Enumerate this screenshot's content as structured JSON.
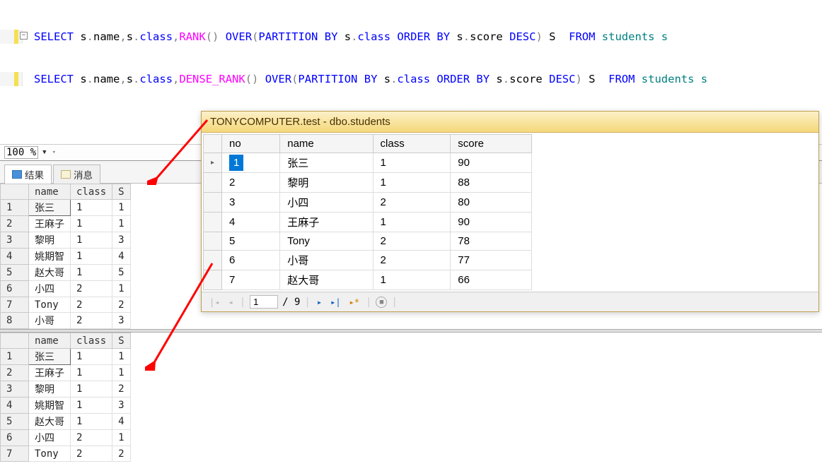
{
  "sql": {
    "line1": {
      "select": "SELECT",
      "cols": " s",
      "dot1": ".",
      "name": "name",
      "comma1": ",",
      "s2": "s",
      "dot2": ".",
      "class": "class",
      "comma2": ",",
      "rank": "RANK",
      "paren1": "()",
      "over": " OVER",
      "paren2": "(",
      "partition": "PARTITION",
      "by": " BY",
      "s3": " s",
      "dot3": ".",
      "class2": "class",
      "order": " ORDER",
      "by2": " BY",
      "s4": " s",
      "dot4": ".",
      "score": "score",
      "desc": " DESC",
      "paren3": ")",
      "alias": " S ",
      "from": " FROM",
      "table": " students s"
    },
    "line2": {
      "select": "SELECT",
      "cols": " s",
      "dot1": ".",
      "name": "name",
      "comma1": ",",
      "s2": "s",
      "dot2": ".",
      "class": "class",
      "comma2": ",",
      "rank": "DENSE_RANK",
      "paren1": "()",
      "over": " OVER",
      "paren2": "(",
      "partition": "PARTITION",
      "by": " BY",
      "s3": " s",
      "dot3": ".",
      "class2": "class",
      "order": " ORDER",
      "by2": " BY",
      "s4": " s",
      "dot4": ".",
      "score": "score",
      "desc": " DESC",
      "paren3": ")",
      "alias": " S ",
      "from": " FROM",
      "table": " students s"
    }
  },
  "zoom": {
    "value": "100 %"
  },
  "tabs": {
    "results": "结果",
    "messages": "消息"
  },
  "grid1": {
    "headers": {
      "rownum": "",
      "name": "name",
      "class": "class",
      "s": "S"
    },
    "rows": [
      {
        "n": "1",
        "name": "张三",
        "class": "1",
        "s": "1"
      },
      {
        "n": "2",
        "name": "王麻子",
        "class": "1",
        "s": "1"
      },
      {
        "n": "3",
        "name": "黎明",
        "class": "1",
        "s": "3"
      },
      {
        "n": "4",
        "name": "姚期智",
        "class": "1",
        "s": "4"
      },
      {
        "n": "5",
        "name": "赵大哥",
        "class": "1",
        "s": "5"
      },
      {
        "n": "6",
        "name": "小四",
        "class": "2",
        "s": "1"
      },
      {
        "n": "7",
        "name": "Tony",
        "class": "2",
        "s": "2"
      },
      {
        "n": "8",
        "name": "小哥",
        "class": "2",
        "s": "3"
      }
    ]
  },
  "grid2": {
    "headers": {
      "rownum": "",
      "name": "name",
      "class": "class",
      "s": "S"
    },
    "rows": [
      {
        "n": "1",
        "name": "张三",
        "class": "1",
        "s": "1"
      },
      {
        "n": "2",
        "name": "王麻子",
        "class": "1",
        "s": "1"
      },
      {
        "n": "3",
        "name": "黎明",
        "class": "1",
        "s": "2"
      },
      {
        "n": "4",
        "name": "姚期智",
        "class": "1",
        "s": "3"
      },
      {
        "n": "5",
        "name": "赵大哥",
        "class": "1",
        "s": "4"
      },
      {
        "n": "6",
        "name": "小四",
        "class": "2",
        "s": "1"
      },
      {
        "n": "7",
        "name": "Tony",
        "class": "2",
        "s": "2"
      }
    ]
  },
  "floatWin": {
    "title": "TONYCOMPUTER.test - dbo.students",
    "headers": {
      "no": "no",
      "name": "name",
      "class": "class",
      "score": "score"
    },
    "rows": [
      {
        "no": "1",
        "name": "张三",
        "class": "1",
        "score": "90"
      },
      {
        "no": "2",
        "name": "黎明",
        "class": "1",
        "score": "88"
      },
      {
        "no": "3",
        "name": "小四",
        "class": "2",
        "score": "80"
      },
      {
        "no": "4",
        "name": "王麻子",
        "class": "1",
        "score": "90"
      },
      {
        "no": "5",
        "name": "Tony",
        "class": "2",
        "score": "78"
      },
      {
        "no": "6",
        "name": "小哥",
        "class": "2",
        "score": "77"
      },
      {
        "no": "7",
        "name": "赵大哥",
        "class": "1",
        "score": "66"
      }
    ],
    "nav": {
      "pos": "1",
      "total": "/ 9"
    }
  }
}
